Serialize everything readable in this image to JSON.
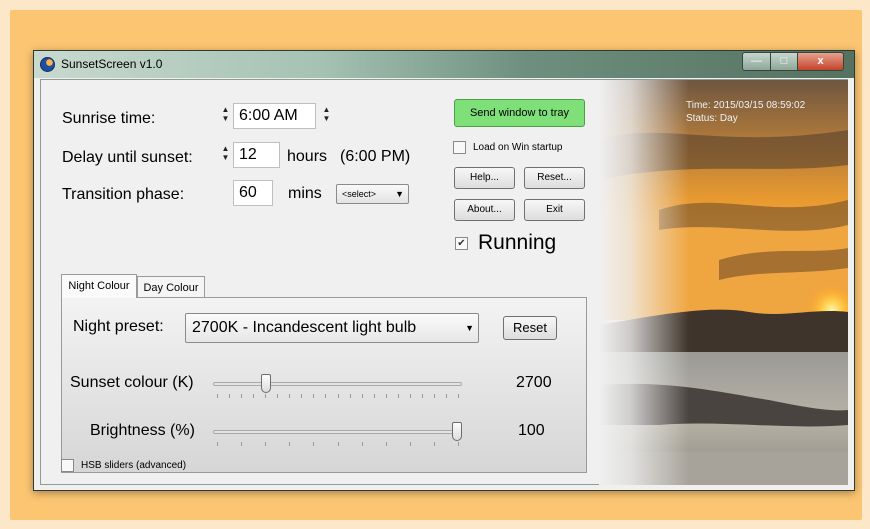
{
  "window": {
    "title": "SunsetScreen v1.0",
    "controls": {
      "minimize": "—",
      "maximize": "□",
      "close": "x"
    }
  },
  "status": {
    "time_line": "Time: 2015/03/15 08:59:02",
    "status_line": "Status: Day"
  },
  "settings": {
    "sunrise_label": "Sunrise time:",
    "sunrise_value": "6:00 AM",
    "delay_label": "Delay until sunset:",
    "delay_value": "12",
    "delay_unit": "hours",
    "delay_result": "(6:00 PM)",
    "transition_label": "Transition phase:",
    "transition_value": "60",
    "transition_unit": "mins",
    "transition_select": "<select>"
  },
  "buttons": {
    "send_to_tray": "Send window to tray",
    "load_on_startup_label": "Load on Win startup",
    "help": "Help...",
    "reset": "Reset...",
    "about": "About...",
    "exit": "Exit"
  },
  "running": {
    "label": "Running",
    "checked": true
  },
  "tabs": [
    {
      "label": "Night Colour",
      "active": true
    },
    {
      "label": "Day Colour",
      "active": false
    }
  ],
  "night_panel": {
    "preset_label": "Night preset:",
    "preset_value": "2700K - Incandescent light bulb",
    "reset_label": "Reset",
    "sunset_colour_label": "Sunset colour (K)",
    "sunset_colour_value": "2700",
    "sunset_colour_fraction": 0.2,
    "brightness_label": "Brightness (%)",
    "brightness_value": "100",
    "brightness_fraction": 1.0
  },
  "hsb": {
    "label": "HSB sliders (advanced)",
    "checked": false
  },
  "colors": {
    "tray_button": "#7fe07a",
    "frame": "#fbc572"
  }
}
